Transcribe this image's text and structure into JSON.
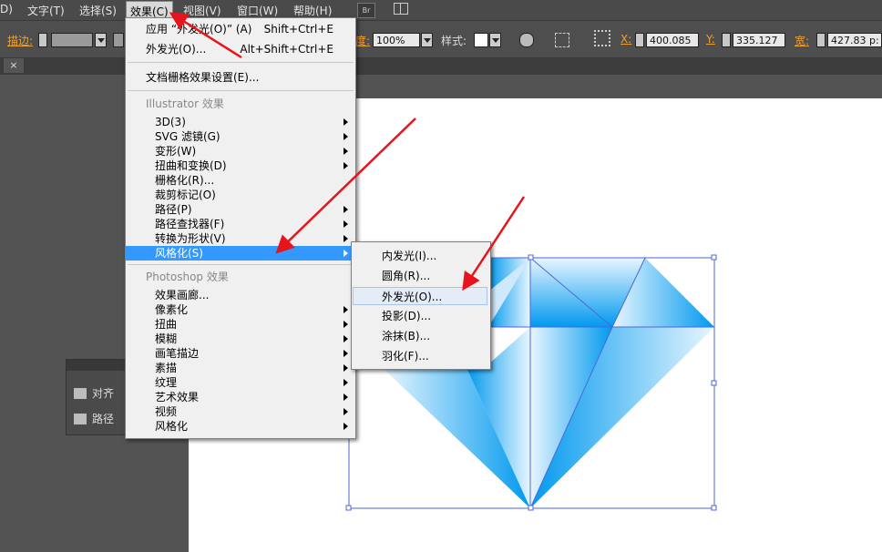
{
  "menubar": {
    "items": [
      {
        "label": "D)"
      },
      {
        "label": "文字(T)"
      },
      {
        "label": "选择(S)"
      },
      {
        "label": "效果(C)"
      },
      {
        "label": "视图(V)"
      },
      {
        "label": "窗口(W)"
      },
      {
        "label": "帮助(H)"
      }
    ],
    "bridge_label": "Br"
  },
  "control_bar": {
    "stroke_label": "描边:",
    "opacity_label": "度:",
    "opacity_value": "100%",
    "style_label": "样式:",
    "x_label": "X:",
    "x_value": "400.085",
    "y_label": "Y:",
    "y_value": "335.127",
    "w_label": "宽:",
    "w_value": "427.83 p:"
  },
  "doc_tab": {
    "close": "×"
  },
  "panel": {
    "items": [
      {
        "label": "对齐"
      },
      {
        "label": "路径"
      }
    ]
  },
  "effect_menu": {
    "apply_label": "应用 “外发光(O)” (A)",
    "apply_shortcut": "Shift+Ctrl+E",
    "last_label": "外发光(O)...",
    "last_shortcut": "Alt+Shift+Ctrl+E",
    "raster_settings": "文档栅格效果设置(E)...",
    "illustrator_header": "Illustrator 效果",
    "illustrator_items": [
      {
        "label": "3D(3)",
        "submenu": true
      },
      {
        "label": "SVG 滤镜(G)",
        "submenu": true
      },
      {
        "label": "变形(W)",
        "submenu": true
      },
      {
        "label": "扭曲和变换(D)",
        "submenu": true
      },
      {
        "label": "栅格化(R)...",
        "submenu": false
      },
      {
        "label": "裁剪标记(O)",
        "submenu": false
      },
      {
        "label": "路径(P)",
        "submenu": true
      },
      {
        "label": "路径查找器(F)",
        "submenu": true
      },
      {
        "label": "转换为形状(V)",
        "submenu": true
      },
      {
        "label": "风格化(S)",
        "submenu": true
      }
    ],
    "photoshop_header": "Photoshop 效果",
    "photoshop_items": [
      {
        "label": "效果画廊...",
        "submenu": false
      },
      {
        "label": "像素化",
        "submenu": true
      },
      {
        "label": "扭曲",
        "submenu": true
      },
      {
        "label": "模糊",
        "submenu": true
      },
      {
        "label": "画笔描边",
        "submenu": true
      },
      {
        "label": "素描",
        "submenu": true
      },
      {
        "label": "纹理",
        "submenu": true
      },
      {
        "label": "艺术效果",
        "submenu": true
      },
      {
        "label": "视频",
        "submenu": true
      },
      {
        "label": "风格化",
        "submenu": true
      }
    ]
  },
  "stylize_submenu": {
    "items": [
      {
        "label": "内发光(I)..."
      },
      {
        "label": "圆角(R)..."
      },
      {
        "label": "外发光(O)..."
      },
      {
        "label": "投影(D)..."
      },
      {
        "label": "涂抹(B)..."
      },
      {
        "label": "羽化(F)..."
      }
    ]
  },
  "colors": {
    "highlight": "#3399ff",
    "annotation_arrow": "#e8141b",
    "label_orange": "#f0a030",
    "diamond_blue": "#0099ee"
  }
}
